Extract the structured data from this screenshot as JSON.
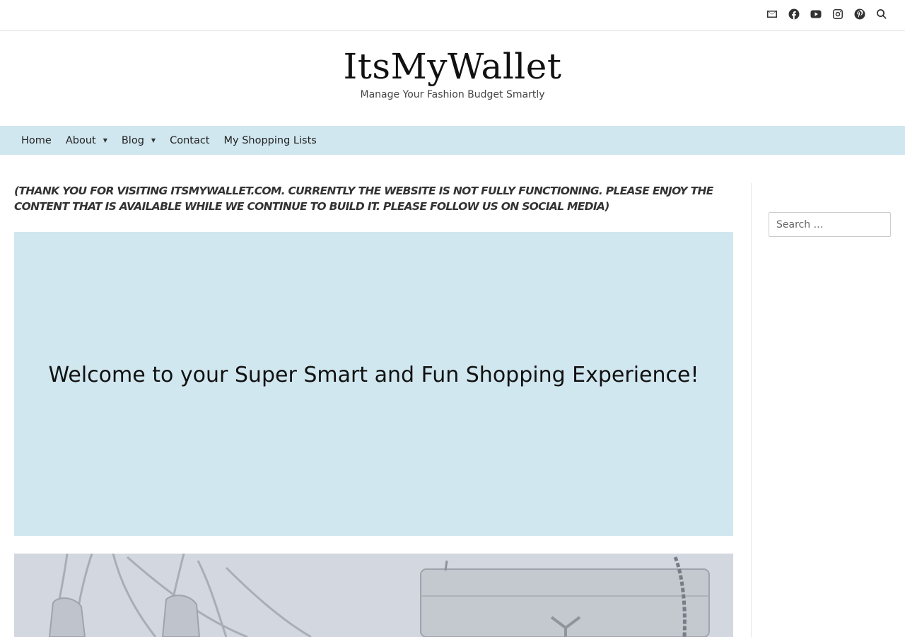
{
  "header": {
    "social_icons": [
      "envelope-icon",
      "facebook-icon",
      "youtube-icon",
      "instagram-icon",
      "pinterest-icon",
      "search-icon"
    ],
    "site_title": "ItsMyWallet",
    "tagline": "Manage Your Fashion Budget Smartly"
  },
  "nav": {
    "items": [
      {
        "label": "Home"
      },
      {
        "label": "About"
      },
      {
        "label": "Blog"
      },
      {
        "label": "Contact"
      },
      {
        "label": "My Shopping Lists"
      }
    ]
  },
  "main": {
    "notice": "(THANK YOU FOR VISITING ITSMYWALLET.COM. CURRENTLY THE WEBSITE IS NOT FULLY FUNCTIONING. PLEASE ENJOY THE CONTENT THAT IS AVAILABLE WHILE WE CONTINUE TO BUILD IT. PLEASE FOLLOW US ON SOCIAL MEDIA)",
    "hero_heading": "Welcome to your Super Smart and Fun Shopping Experience!"
  },
  "sidebar": {
    "search_placeholder": "Search …"
  },
  "colors": {
    "accent_bg": "#d1e7ef",
    "photo_bg": "#d3d7df"
  }
}
